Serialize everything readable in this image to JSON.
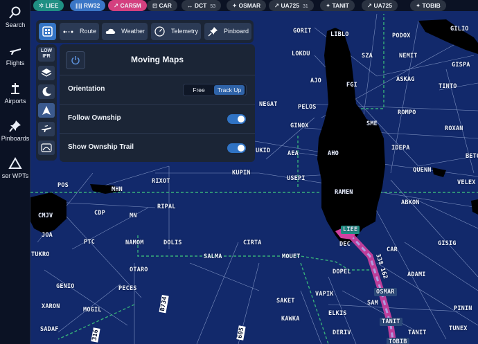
{
  "nav": {
    "items": [
      {
        "label": "Search",
        "icon": "search-icon"
      },
      {
        "label": "Flights",
        "icon": "plane-icon"
      },
      {
        "label": "Airports",
        "icon": "airport-icon"
      },
      {
        "label": "Pinboards",
        "icon": "pin-icon"
      },
      {
        "label": "ser WPTs",
        "icon": "triangle-icon"
      }
    ]
  },
  "route": {
    "chips": [
      {
        "label": "LIEE",
        "count": "",
        "style": "teal"
      },
      {
        "label": "RW32",
        "count": "",
        "style": "blue"
      },
      {
        "label": "CAR5M",
        "count": "",
        "style": "pink"
      },
      {
        "label": "CAR",
        "count": "",
        "style": "gray"
      },
      {
        "label": "DCT",
        "count": "53",
        "style": "gray"
      },
      {
        "label": "OSMAR",
        "count": "",
        "style": "gray"
      },
      {
        "label": "UA725",
        "count": "31",
        "style": "gray"
      },
      {
        "label": "TANIT",
        "count": "",
        "style": "gray"
      },
      {
        "label": "UA725",
        "count": "",
        "style": "gray"
      },
      {
        "label": "TOBIB",
        "count": "",
        "style": "gray"
      }
    ]
  },
  "toolbar": {
    "route_label": "Route",
    "weather_label": "Weather",
    "telemetry_label": "Telemetry",
    "pinboard_label": "Pinboard"
  },
  "side_tools": {
    "lowifr_line1": "LOW",
    "lowifr_line2": "IFR"
  },
  "panel": {
    "title": "Moving Maps",
    "orientation_label": "Orientation",
    "orientation_free": "Free",
    "orientation_track_up": "Track Up",
    "orientation_selected": "Track Up",
    "follow_label": "Follow Ownship",
    "follow_on": true,
    "trail_label": "Show Ownship Trail",
    "trail_on": true
  },
  "map": {
    "waypoints": [
      "GORIT",
      "LIBLO",
      "PODOX",
      "GILIO",
      "LOKDU",
      "SZA",
      "NEMIT",
      "GISPA",
      "AJO",
      "FGI",
      "ASKAG",
      "TINTO",
      "NEGAT",
      "PELOS",
      "ROMPO",
      "GINOX",
      "SME",
      "ROXAN",
      "UKID",
      "AEA",
      "AHO",
      "IDEPA",
      "BETO",
      "KUPIN",
      "QUENN",
      "USEPI",
      "VELEX",
      "RIXOT",
      "POS",
      "MHN",
      "RAMEN",
      "ABKON",
      "RIPAL",
      "CMJV",
      "CDP",
      "MN",
      "JOA",
      "PTC",
      "NAMOM",
      "DOLIS",
      "CIRTA",
      "GISIG",
      "TUKRO",
      "SALMA",
      "MOUET",
      "CAR",
      "OTARO",
      "DOPEL",
      "ADAMI",
      "GENIO",
      "PECES",
      "VAPIK",
      "SAKET",
      "XARON",
      "MOGIL",
      "PININ",
      "ELKIS",
      "KAWKA",
      "SADAF",
      "DERIV",
      "TANIT",
      "TUNEX",
      "B734",
      "605",
      "316"
    ],
    "airport_label": "LIEE",
    "airport_sub": "DEC",
    "route_labels": {
      "osmar": "OSMAR",
      "tanit": "TANIT",
      "tobib": "TOBIB",
      "sam": "SAM",
      "leg": "338 162"
    },
    "colors": {
      "water": "#12296b",
      "land": "#000000",
      "route": "#d040a0",
      "fir_border": "#37b07a"
    }
  }
}
